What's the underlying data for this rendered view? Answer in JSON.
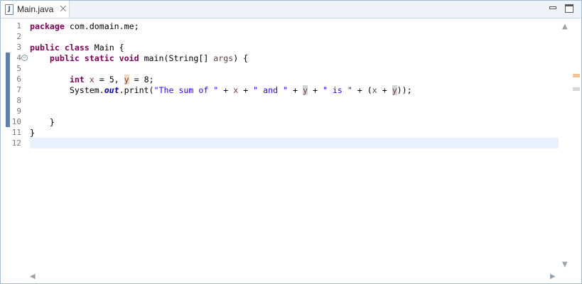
{
  "tab": {
    "icon": "java-file-icon",
    "icon_glyph": "J",
    "title": "Main.java",
    "close_glyph": "⨉"
  },
  "window_controls": {
    "minimize": "minimize-icon",
    "maximize": "maximize-icon"
  },
  "line_numbers": [
    "1",
    "2",
    "3",
    "4",
    "5",
    "6",
    "7",
    "8",
    "9",
    "10",
    "11",
    "12"
  ],
  "fold_marker": {
    "line": 4,
    "glyph": "−"
  },
  "quick_diff_lines": [
    4,
    5,
    6,
    7,
    8,
    9,
    10
  ],
  "current_line": 12,
  "code_lines": [
    [
      {
        "t": "package",
        "c": "kw"
      },
      {
        "t": " com.domain.me;"
      }
    ],
    [],
    [
      {
        "t": "public",
        "c": "kw"
      },
      {
        "t": " "
      },
      {
        "t": "class",
        "c": "kw"
      },
      {
        "t": " Main {"
      }
    ],
    [
      {
        "t": "    "
      },
      {
        "t": "public",
        "c": "kw"
      },
      {
        "t": " "
      },
      {
        "t": "static",
        "c": "kw"
      },
      {
        "t": " "
      },
      {
        "t": "void",
        "c": "kw"
      },
      {
        "t": " main(String[] "
      },
      {
        "t": "args",
        "c": "var"
      },
      {
        "t": ") {"
      }
    ],
    [],
    [
      {
        "t": "        "
      },
      {
        "t": "int",
        "c": "kw"
      },
      {
        "t": " "
      },
      {
        "t": "x",
        "c": "var"
      },
      {
        "t": " = 5, "
      },
      {
        "t": "y",
        "c": "occ-w"
      },
      {
        "t": " = 8;"
      }
    ],
    [
      {
        "t": "        System."
      },
      {
        "t": "out",
        "c": "fld"
      },
      {
        "t": ".print("
      },
      {
        "t": "\"The sum of \"",
        "c": "str"
      },
      {
        "t": " + "
      },
      {
        "t": "x",
        "c": "var"
      },
      {
        "t": " + "
      },
      {
        "t": "\" and \"",
        "c": "str"
      },
      {
        "t": " + "
      },
      {
        "t": "y",
        "c": "occ-r"
      },
      {
        "t": " + "
      },
      {
        "t": "\" is \"",
        "c": "str"
      },
      {
        "t": " + ("
      },
      {
        "t": "x",
        "c": "var"
      },
      {
        "t": " + "
      },
      {
        "t": "y",
        "c": "occ-r"
      },
      {
        "t": "));"
      }
    ],
    [],
    [],
    [
      {
        "t": "    }"
      }
    ],
    [
      {
        "t": "}"
      }
    ],
    []
  ],
  "overview_marks": [
    {
      "line": 6,
      "color": "#f0c890"
    },
    {
      "line": 7,
      "color": "#d8d8d8"
    }
  ],
  "scroll_arrows": {
    "up": "▲",
    "down": "▼",
    "left": "◀",
    "right": "▶"
  }
}
